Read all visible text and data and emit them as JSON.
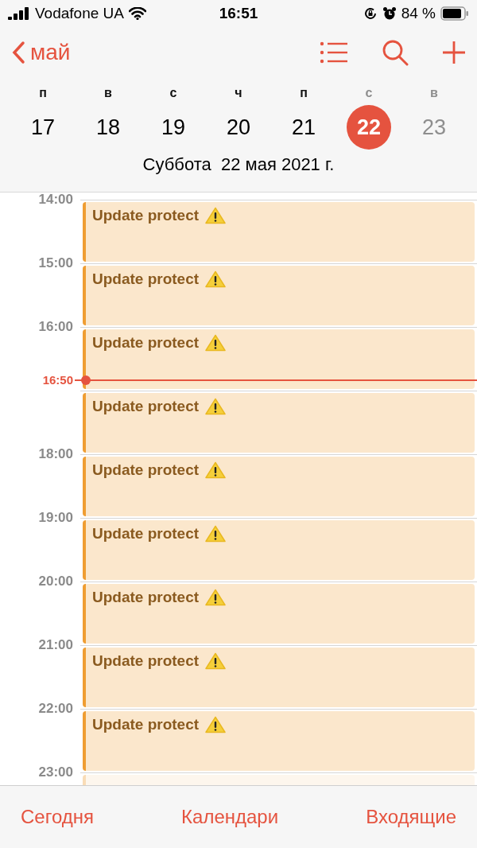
{
  "status_bar": {
    "carrier": "Vodafone UA",
    "time": "16:51",
    "battery": "84 %"
  },
  "nav": {
    "back_label": "май"
  },
  "week": [
    {
      "weekday": "п",
      "number": "17",
      "selected": false,
      "weekend": false
    },
    {
      "weekday": "в",
      "number": "18",
      "selected": false,
      "weekend": false
    },
    {
      "weekday": "с",
      "number": "19",
      "selected": false,
      "weekend": false
    },
    {
      "weekday": "ч",
      "number": "20",
      "selected": false,
      "weekend": false
    },
    {
      "weekday": "п",
      "number": "21",
      "selected": false,
      "weekend": false
    },
    {
      "weekday": "с",
      "number": "22",
      "selected": true,
      "weekend": true
    },
    {
      "weekday": "в",
      "number": "23",
      "selected": false,
      "weekend": true
    }
  ],
  "selected_date": "Суббота  22 мая 2021 г.",
  "timeline": {
    "slots": [
      {
        "hour": "14:00",
        "event": {
          "title": "Update protect",
          "warning": true,
          "faded": false
        }
      },
      {
        "hour": "15:00",
        "event": {
          "title": "Update protect",
          "warning": true,
          "faded": false
        }
      },
      {
        "hour": "16:00",
        "now_label": "16:50",
        "event": {
          "title": "Update protect",
          "warning": true,
          "faded": false
        }
      },
      {
        "event": {
          "title": "Update protect",
          "warning": true,
          "faded": false
        }
      },
      {
        "hour": "18:00",
        "event": {
          "title": "Update protect",
          "warning": true,
          "faded": false
        }
      },
      {
        "hour": "19:00",
        "event": {
          "title": "Update protect",
          "warning": true,
          "faded": false
        }
      },
      {
        "hour": "20:00",
        "event": {
          "title": "Update protect",
          "warning": true,
          "faded": false
        }
      },
      {
        "hour": "21:00",
        "event": {
          "title": "Update protect",
          "warning": true,
          "faded": false
        }
      },
      {
        "hour": "22:00",
        "event": {
          "title": "Update protect",
          "warning": true,
          "faded": false
        }
      },
      {
        "hour": "23:00",
        "event": {
          "faded": true
        }
      }
    ]
  },
  "tab_bar": [
    "Сегодня",
    "Календари",
    "Входящие"
  ]
}
